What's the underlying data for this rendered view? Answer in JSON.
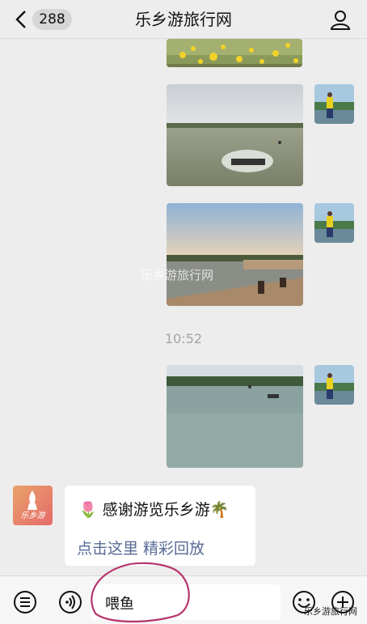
{
  "header": {
    "back_count": "288",
    "title": "乐乡游旅行网"
  },
  "messages": {
    "time": "10:52",
    "watermark": "乐乡游旅行网"
  },
  "bot": {
    "avatar_text": "乐乡游",
    "line1": "🌷 感谢游览乐乡游🌴",
    "link_text": "点击这里 精彩回放"
  },
  "input": {
    "value": "喂鱼"
  },
  "footer_watermark": "乐乡游旅行网",
  "icons": {
    "back": "chevron-left-icon",
    "profile": "person-icon",
    "menu": "list-icon",
    "voice": "voice-icon",
    "emoji": "emoji-icon",
    "add": "plus-icon"
  },
  "colors": {
    "link": "#576b95",
    "background": "#ededed",
    "annotation": "#b5346b"
  }
}
